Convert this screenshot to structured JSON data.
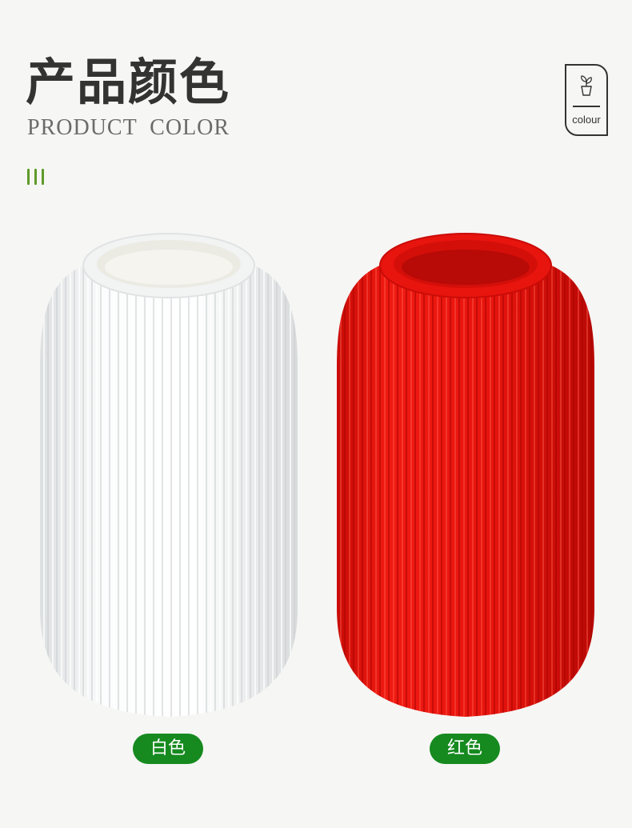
{
  "header": {
    "title_cn": "产品颜色",
    "title_en": "PRODUCT COLOR",
    "badge_text": "colour",
    "badge_icon": "potted-plant-icon",
    "accent_color": "#5e9a2a"
  },
  "products": [
    {
      "label": "白色",
      "color": "#f4f5f5"
    },
    {
      "label": "红色",
      "color": "#e8140e"
    }
  ],
  "label_bg_color": "#168a1f"
}
